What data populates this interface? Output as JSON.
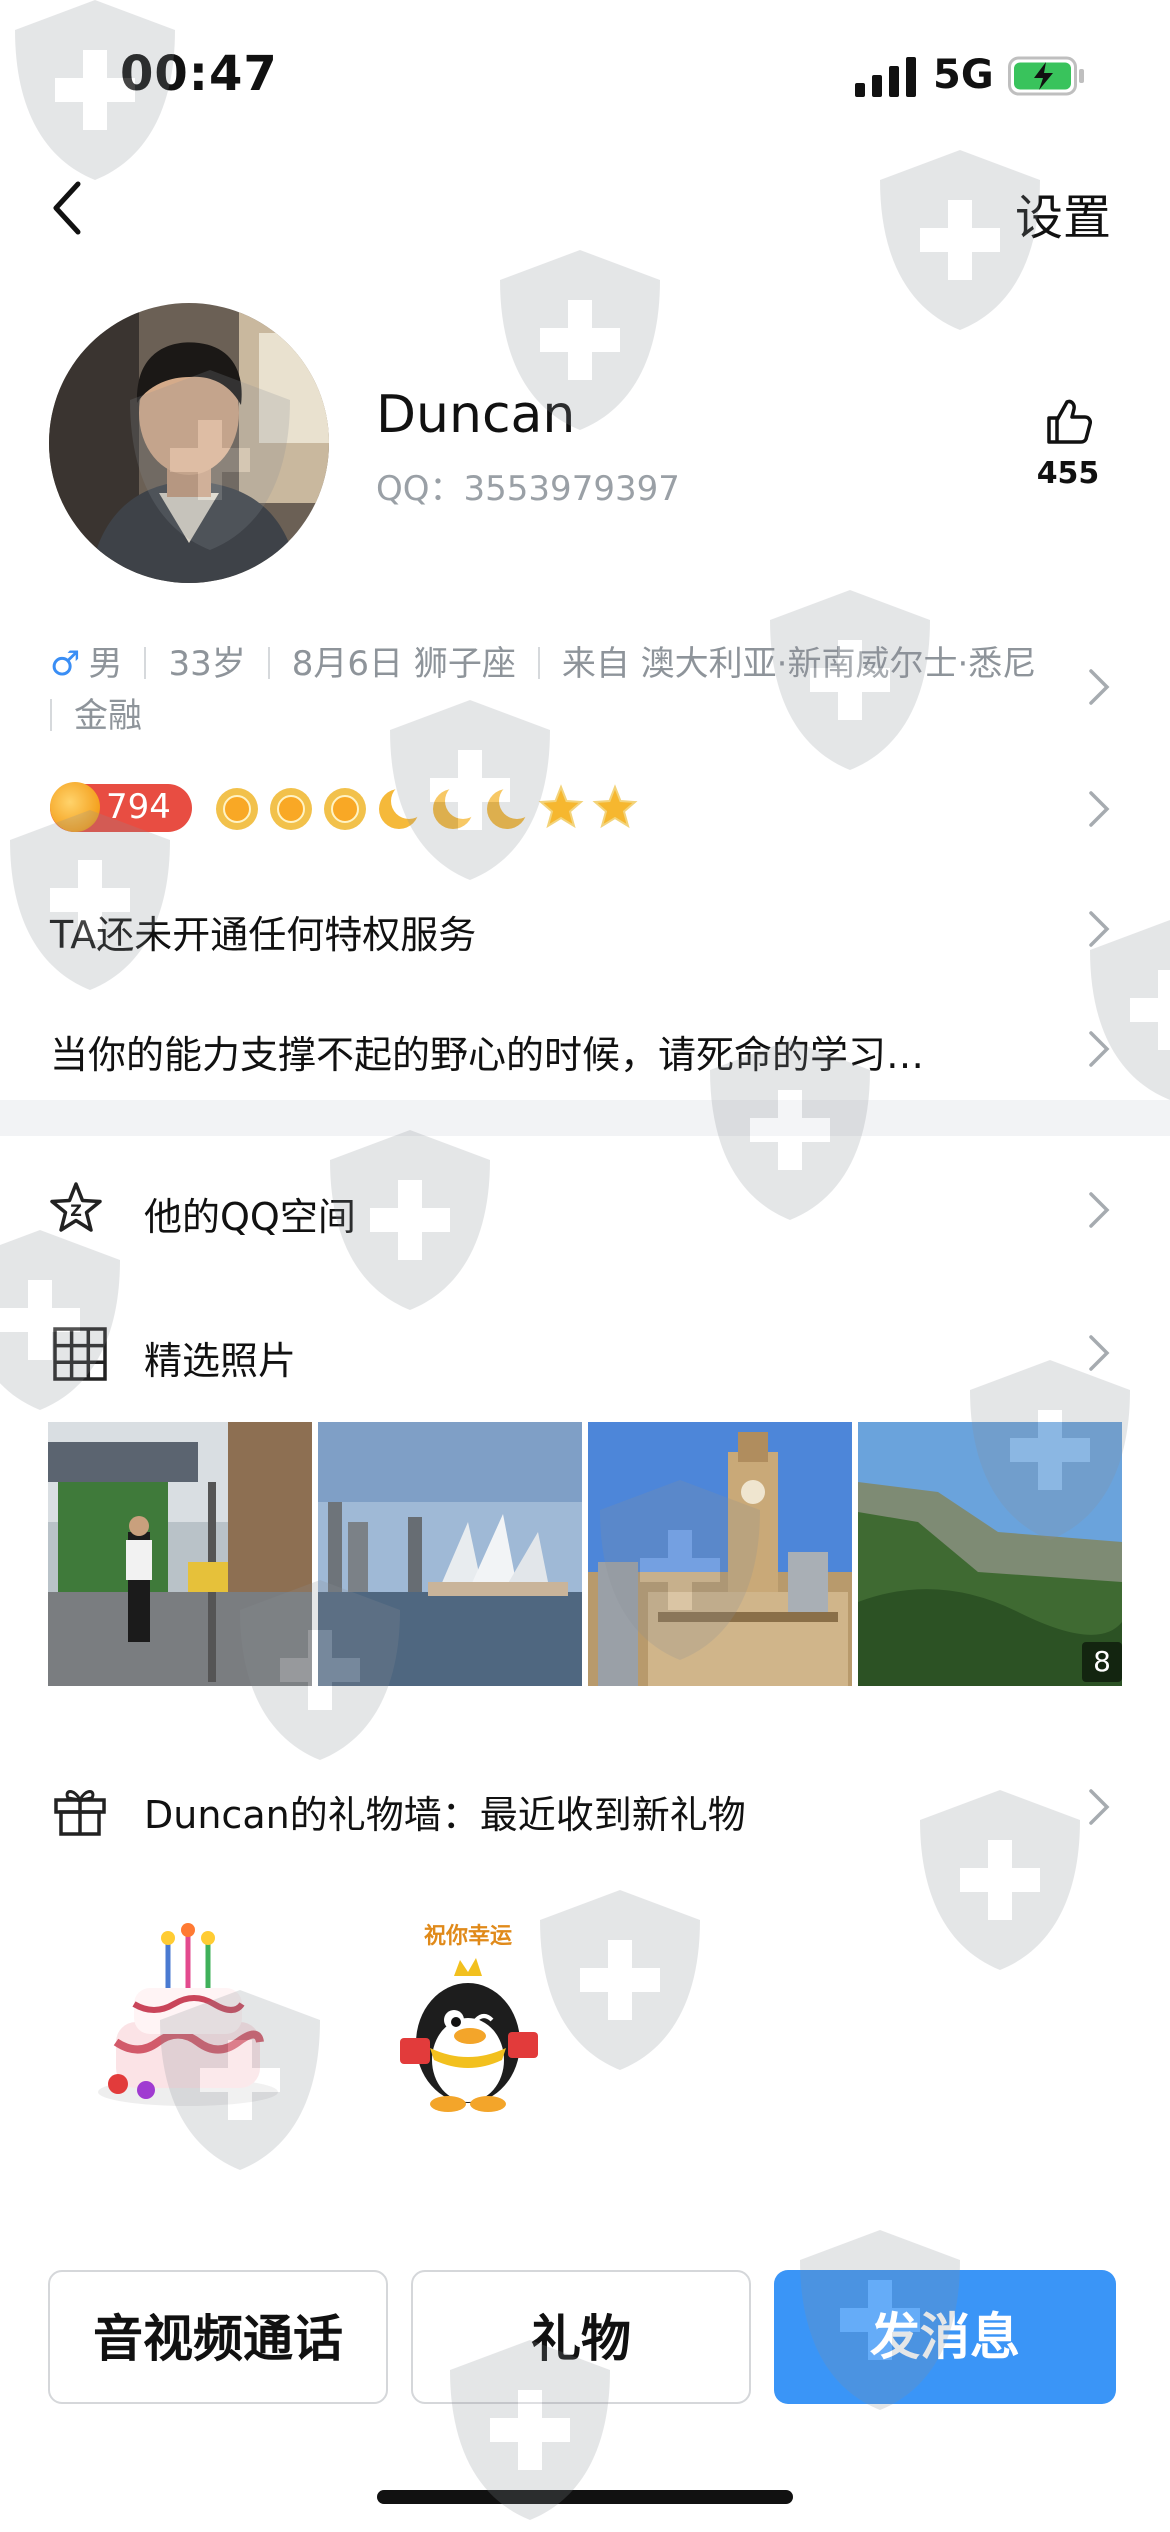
{
  "status_bar": {
    "time": "00:47",
    "network": "5G"
  },
  "nav": {
    "settings_label": "设置"
  },
  "profile": {
    "name": "Duncan",
    "qq_label": "QQ：",
    "qq_number": "3553979397",
    "like_count": "455"
  },
  "info": {
    "gender": "男",
    "age": "33岁",
    "birthday": "8月6日 狮子座",
    "location": "来自 澳大利亚·新南威尔士·悉尼",
    "industry": "金融"
  },
  "level": {
    "value": "794",
    "icons": [
      "sun-icon",
      "sun-icon",
      "sun-icon",
      "moon-icon",
      "moon-icon",
      "moon-icon",
      "star-icon",
      "star-icon"
    ]
  },
  "privilege_text": "TA还未开通任何特权服务",
  "signature": "当你的能力支撑不起的野心的时候，请死命的学习…",
  "menu": {
    "qzone_label": "他的QQ空间",
    "photos_label": "精选照片",
    "photo_count": "8",
    "gift_wall_label": "Duncan的礼物墙：最近收到新礼物",
    "gift2_caption": "祝你幸运"
  },
  "buttons": {
    "call": "音视频通话",
    "gift": "礼物",
    "message": "发消息"
  },
  "colors": {
    "accent": "#3a95f7",
    "level_badge": "#e84d42"
  }
}
